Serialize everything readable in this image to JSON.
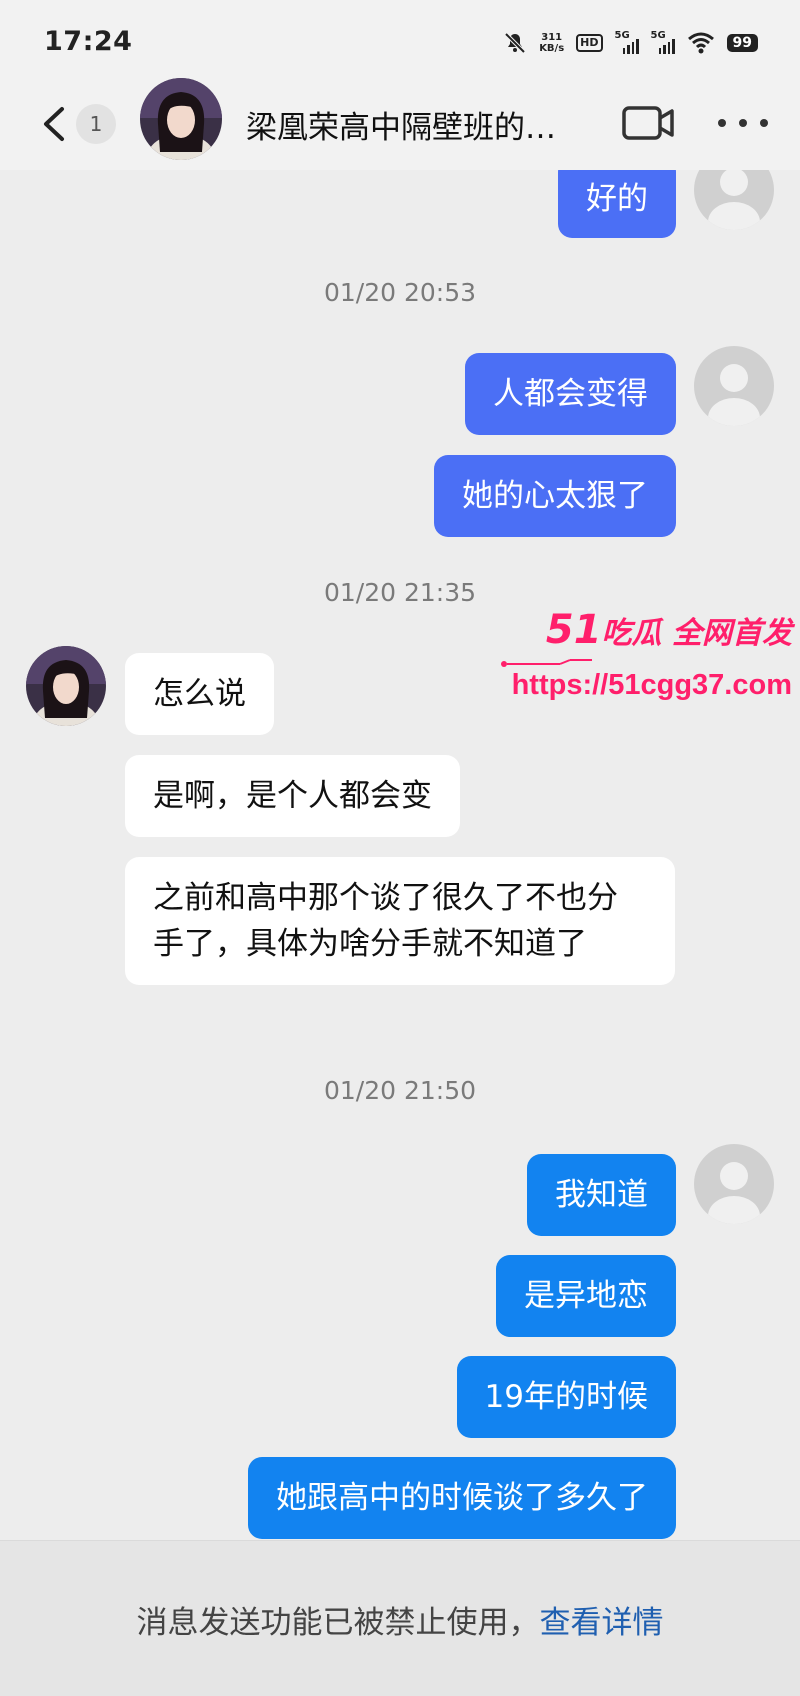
{
  "status_bar": {
    "time": "17:24",
    "speed_value": "311",
    "speed_unit": "KB/s",
    "hd_label": "HD",
    "net1": "5G",
    "net2": "5G",
    "battery": "99"
  },
  "header": {
    "back_count": "1",
    "title": "梁凰荣高中隔壁班的…"
  },
  "messages": [
    {
      "type": "out",
      "text": "好的"
    },
    {
      "type": "timestamp",
      "text": "01/20 20:53"
    },
    {
      "type": "out",
      "text": "人都会变得"
    },
    {
      "type": "out",
      "text": "她的心太狠了"
    },
    {
      "type": "timestamp",
      "text": "01/20 21:35"
    },
    {
      "type": "in",
      "text": "怎么说"
    },
    {
      "type": "in",
      "text": "是啊，是个人都会变"
    },
    {
      "type": "in",
      "text": "之前和高中那个谈了很久了不也分手了，具体为啥分手就不知道了"
    },
    {
      "type": "timestamp",
      "text": "01/20 21:50"
    },
    {
      "type": "out",
      "text": "我知道"
    },
    {
      "type": "out",
      "text": "是异地恋"
    },
    {
      "type": "out",
      "text": "19年的时候"
    },
    {
      "type": "out",
      "text": "她跟高中的时候谈了多久了"
    }
  ],
  "watermark": {
    "number": "51",
    "brand": "吃瓜 全网首发",
    "url": "https://51cgg37.com"
  },
  "footer": {
    "notice": "消息发送功能已被禁止使用，",
    "link": "查看详情"
  },
  "colors": {
    "outgoing_bubble": "#4b6ff5",
    "outgoing_bubble_alt": "#1283f0",
    "incoming_bubble": "#ffffff",
    "background": "#ededed",
    "watermark": "#ff1f6b",
    "link": "#1f5fb0"
  }
}
